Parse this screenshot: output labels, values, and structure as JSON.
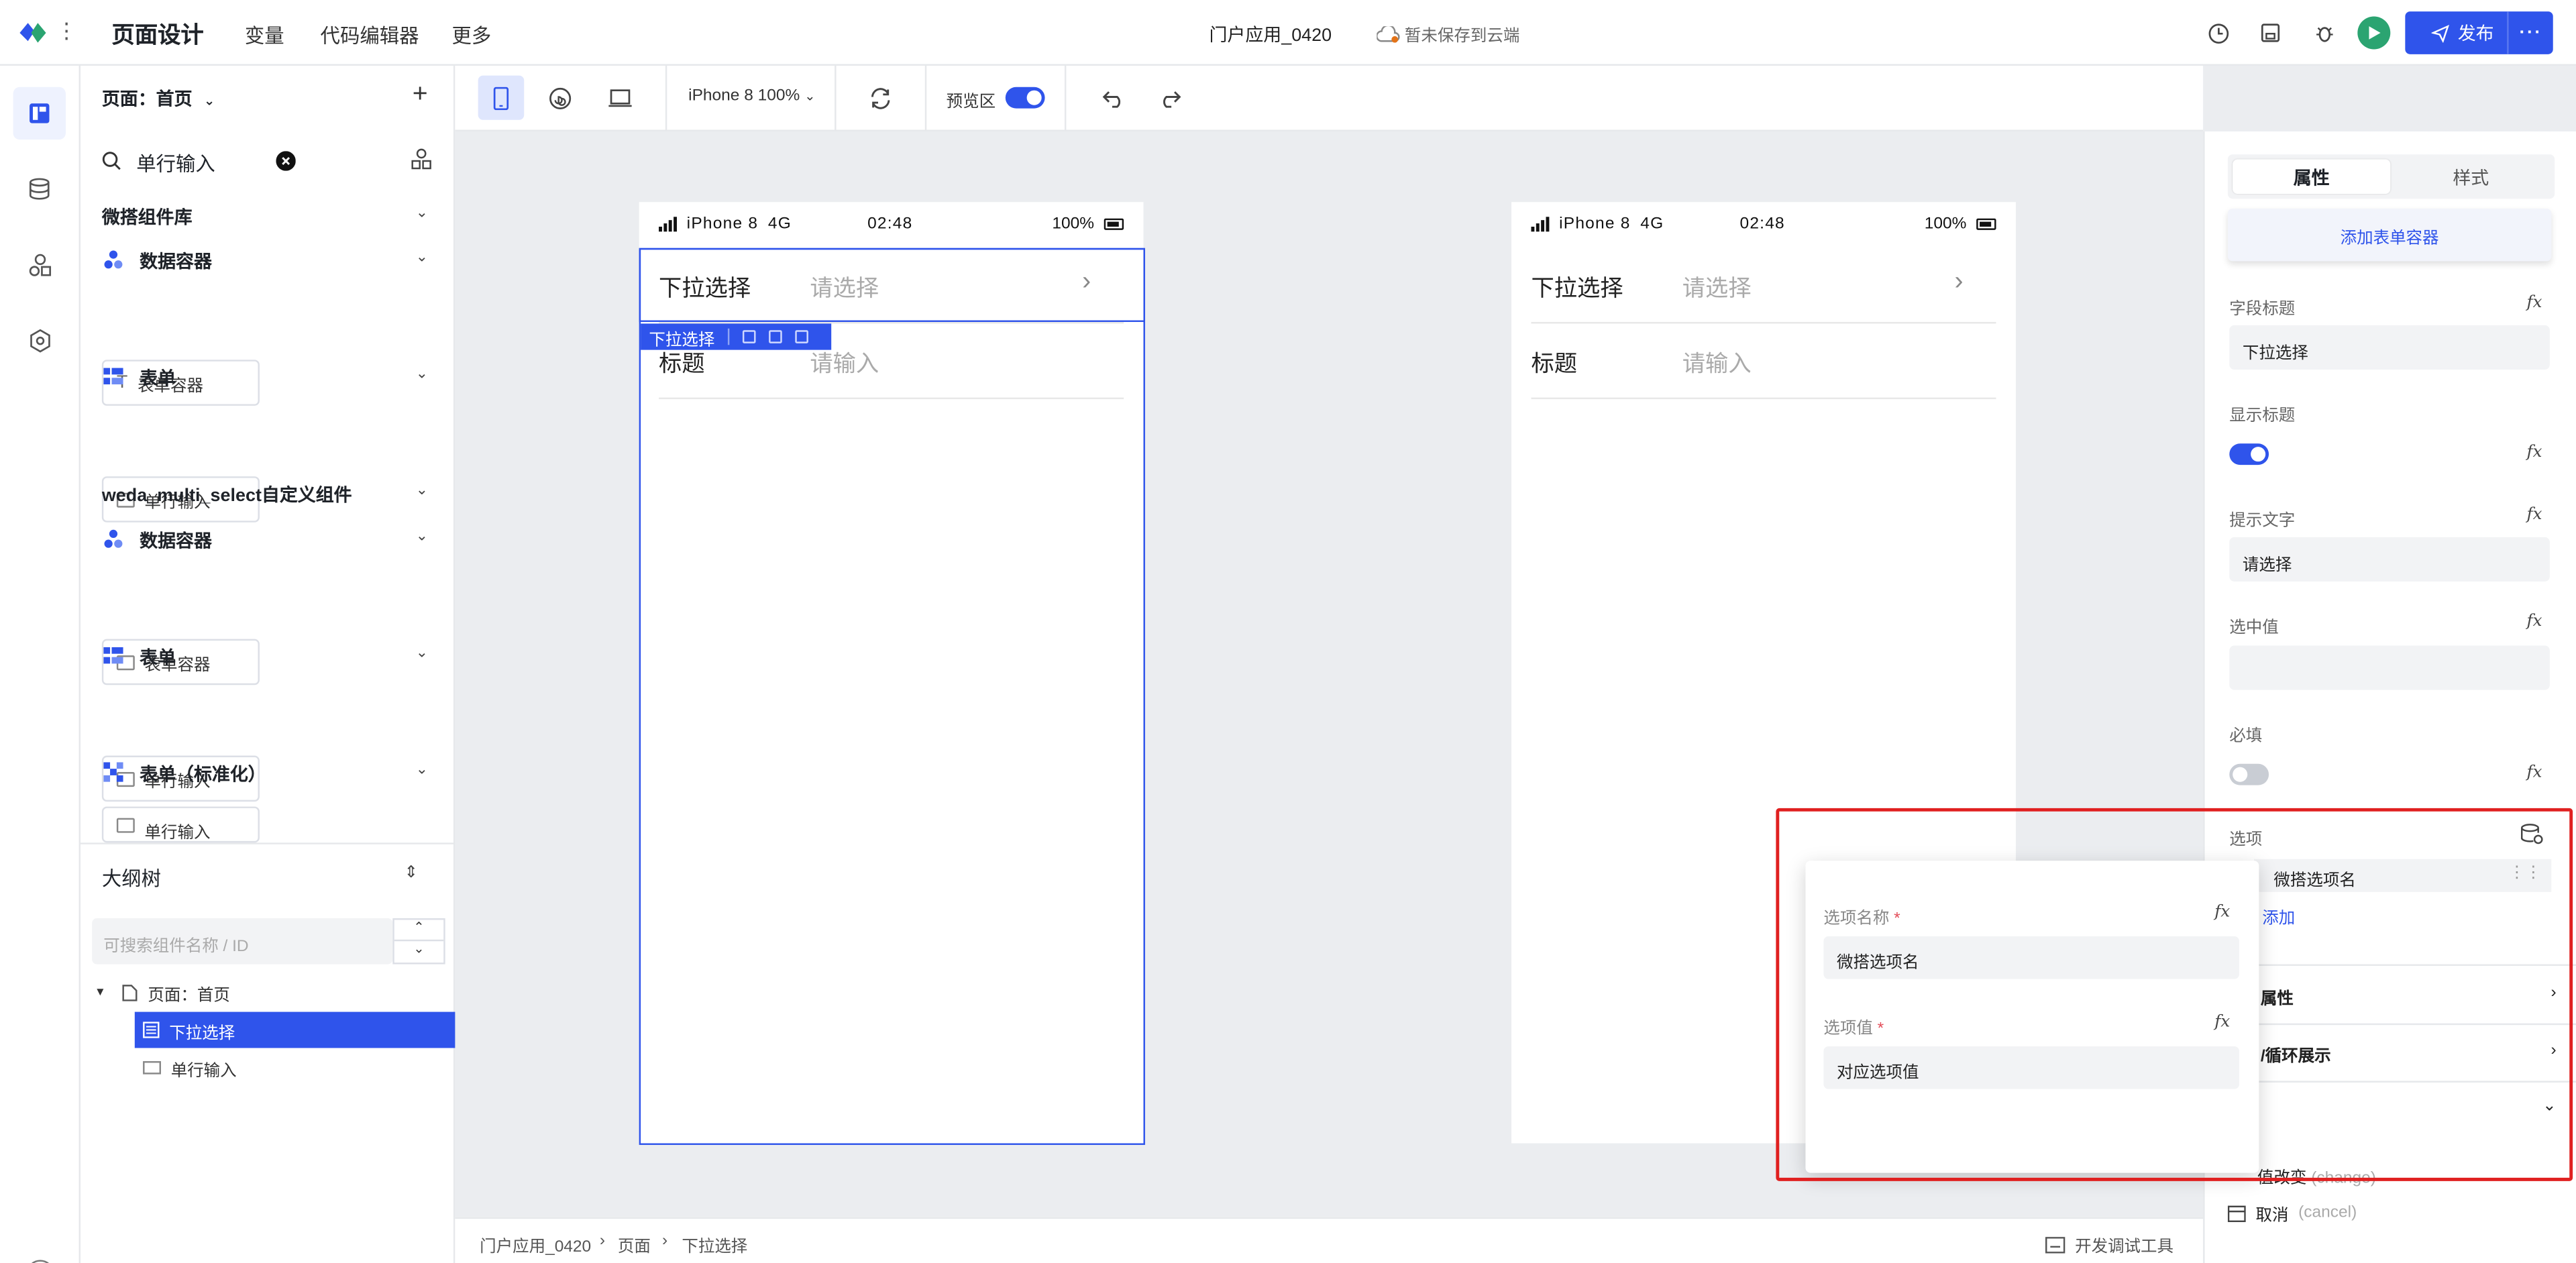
{
  "topbar": {
    "app_title": "页面设计",
    "nav": [
      "变量",
      "代码编辑器",
      "更多"
    ],
    "project_title": "门户应用_0420",
    "save_status": "暂未保存到云端",
    "publish_label": "发布",
    "more_label": "···"
  },
  "left_panel": {
    "page_label": "页面：首页",
    "search_value": "单行输入",
    "library_title": "微搭组件库",
    "custom_title": "weda_multi_select自定义组件",
    "groups": [
      {
        "title": "数据容器",
        "item": "表单容器"
      },
      {
        "title": "表单",
        "item": "单行输入"
      },
      {
        "title": "数据容器",
        "item": "表单容器"
      },
      {
        "title": "表单",
        "item": "单行输入"
      },
      {
        "title": "表单（标准化）",
        "item": "单行输入"
      }
    ],
    "outline_title": "大纲树",
    "outline_search_placeholder": "可搜索组件名称 / ID",
    "tree": {
      "root": "页面：首页",
      "selected": "下拉选择",
      "child": "单行输入"
    }
  },
  "toolbar": {
    "device": "iPhone 8 100%",
    "preview_label": "预览区"
  },
  "phone": {
    "carrier": "iPhone 8",
    "network": "4G",
    "time": "02:48",
    "battery": "100%",
    "rows": [
      {
        "label": "下拉选择",
        "placeholder": "请选择"
      },
      {
        "label": "标题",
        "placeholder": "请输入"
      }
    ],
    "selection_tag": "下拉选择"
  },
  "breadcrumb": [
    "门户应用_0420",
    "页面",
    "下拉选择"
  ],
  "dev_tools": "开发调试工具",
  "right_panel": {
    "tabs": [
      "属性",
      "样式"
    ],
    "add_container": "添加表单容器",
    "field_title_label": "字段标题",
    "field_title_value": "下拉选择",
    "show_title_label": "显示标题",
    "hint_label": "提示文字",
    "hint_value": "请选择",
    "selected_label": "选中值",
    "required_label": "必填",
    "options_label": "选项",
    "option_item": "微搭选项名",
    "add_label": "添加",
    "section_attr": "属性",
    "section_loop": "/循环展示",
    "event_change": "值改变",
    "event_change_code": "(change)",
    "event_cancel": "取消",
    "event_cancel_code": "(cancel)",
    "fx": "fx"
  },
  "popup": {
    "name_label": "选项名称",
    "name_value": "微搭选项名",
    "value_label": "选项值",
    "value_value": "对应选项值",
    "required_mark": "*"
  },
  "colors": {
    "primary": "#2f54eb",
    "highlight_box": "#e02020",
    "run": "#2ba471"
  }
}
